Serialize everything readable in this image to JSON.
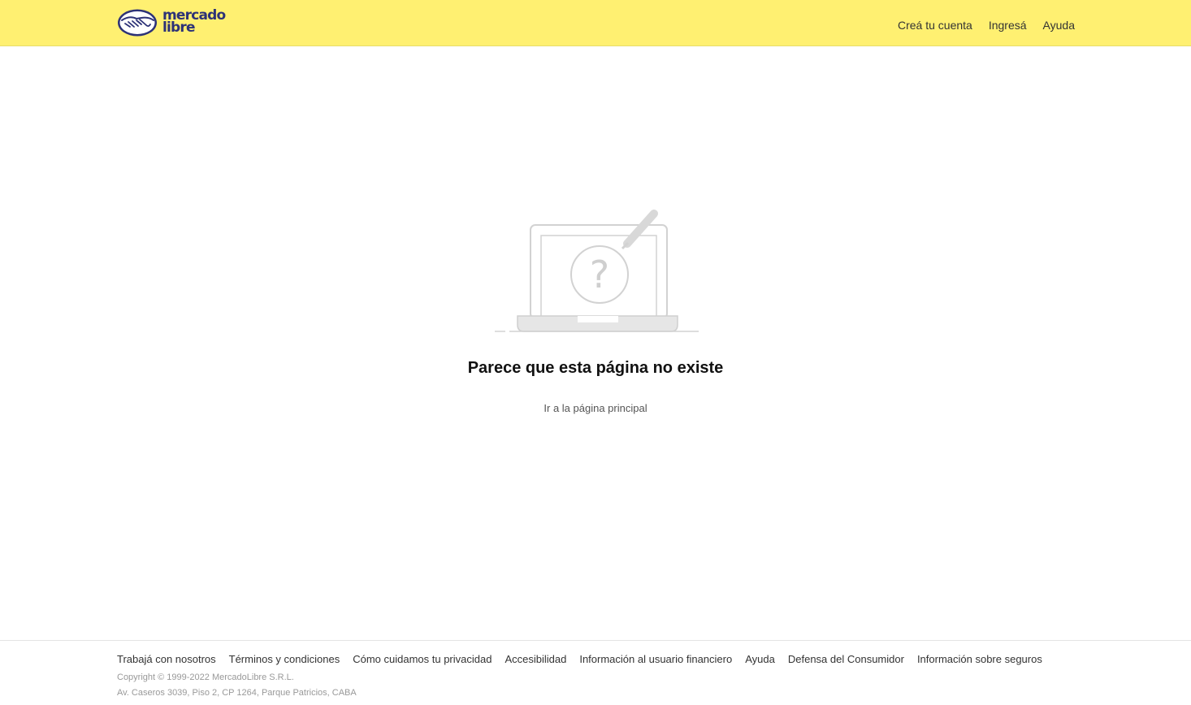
{
  "header": {
    "logo": {
      "line1": "mercado",
      "line2": "libre",
      "icon": "handshake-icon"
    },
    "nav": {
      "create_account": "Creá tu cuenta",
      "login": "Ingresá",
      "help": "Ayuda"
    }
  },
  "main": {
    "illustration_icon": "laptop-question-icon",
    "title": "Parece que esta página no existe",
    "home_link": "Ir a la página principal"
  },
  "footer": {
    "links": [
      "Trabajá con nosotros",
      "Términos y condiciones",
      "Cómo cuidamos tu privacidad",
      "Accesibilidad",
      "Información al usuario financiero",
      "Ayuda",
      "Defensa del Consumidor",
      "Información sobre seguros"
    ],
    "copyright": "Copyright © 1999-2022 MercadoLibre S.R.L.",
    "address": "Av. Caseros 3039, Piso 2, CP 1264, Parque Patricios, CABA"
  },
  "colors": {
    "header_bg": "#fff071",
    "logo_blue": "#2d3277",
    "text_dark": "#333333",
    "footer_muted": "#999999"
  }
}
